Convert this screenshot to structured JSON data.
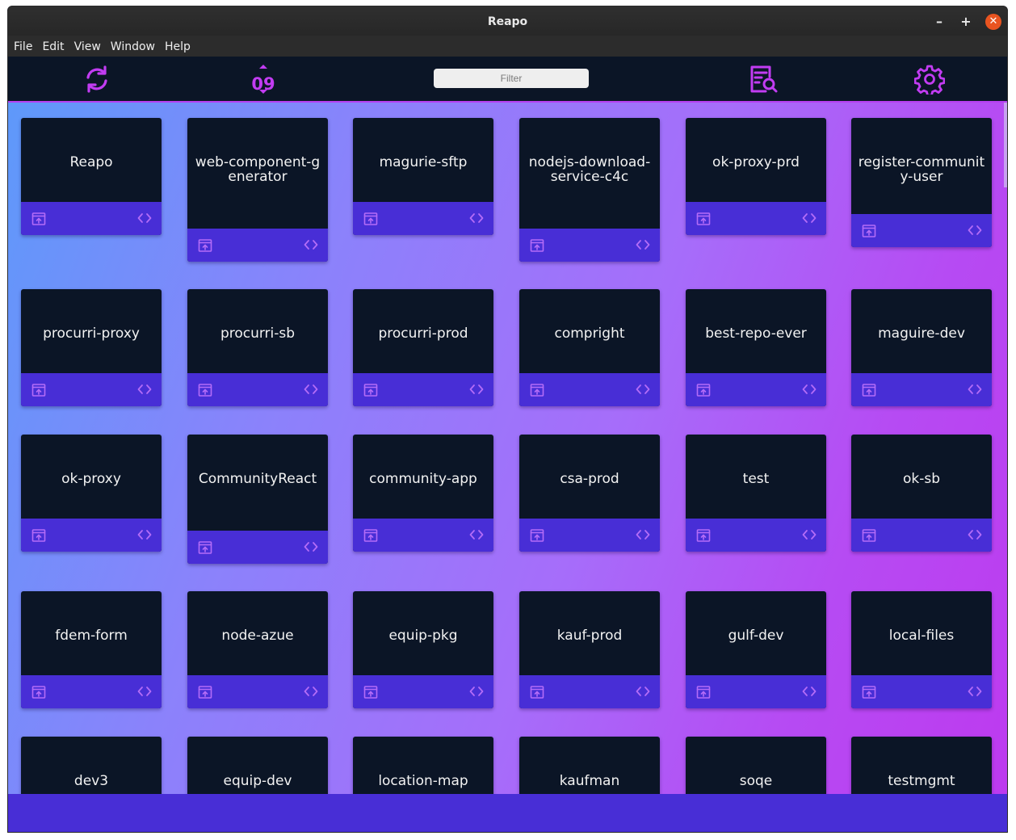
{
  "window": {
    "title": "Reapo"
  },
  "menu": [
    "File",
    "Edit",
    "View",
    "Window",
    "Help"
  ],
  "toolbar": {
    "refresh_icon": "refresh-icon",
    "sort_text": "09",
    "filter_placeholder": "Filter",
    "filter_value": "",
    "search_icon": "file-search-icon",
    "settings_icon": "gear-icon"
  },
  "colors": {
    "accent": "#c23cf2",
    "card_bg": "#0b1526",
    "card_bar": "#482ed6"
  },
  "repos": [
    "Reapo",
    "web-component-generator",
    "magurie-sftp",
    "nodejs-download-service-c4c",
    "ok-proxy-prd",
    "register-community-user",
    "procurri-proxy",
    "procurri-sb",
    "procurri-prod",
    "compright",
    "best-repo-ever",
    "maguire-dev",
    "ok-proxy",
    "CommunityReact",
    "community-app",
    "csa-prod",
    "test",
    "ok-sb",
    "fdem-form",
    "node-azue",
    "equip-pkg",
    "kauf-prod",
    "gulf-dev",
    "local-files",
    "dev3",
    "equip-dev",
    "location-map",
    "kaufman",
    "soqe",
    "testmgmt"
  ]
}
